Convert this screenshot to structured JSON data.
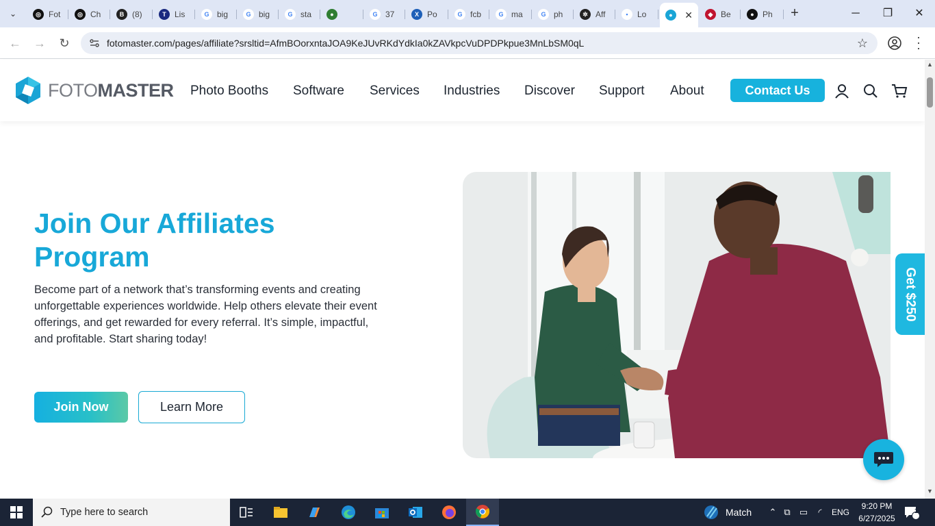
{
  "browser": {
    "tabs": [
      {
        "label": "Fot",
        "icon": "openai-icon"
      },
      {
        "label": "Ch",
        "icon": "openai-icon"
      },
      {
        "label": "(8)",
        "icon": "b-icon"
      },
      {
        "label": "Lis",
        "icon": "ttp-icon"
      },
      {
        "label": "big",
        "icon": "google-icon"
      },
      {
        "label": "big",
        "icon": "google-icon"
      },
      {
        "label": "sta",
        "icon": "google-icon"
      },
      {
        "label": "",
        "icon": "extension-icon"
      },
      {
        "label": "37",
        "icon": "google-icon"
      },
      {
        "label": "Po",
        "icon": "xf-icon"
      },
      {
        "label": "fcb",
        "icon": "google-icon"
      },
      {
        "label": "ma",
        "icon": "google-icon"
      },
      {
        "label": "ph",
        "icon": "google-icon"
      },
      {
        "label": "Aff",
        "icon": "aperture-icon"
      },
      {
        "label": "Lo",
        "icon": "page-icon"
      },
      {
        "label": "",
        "icon": "fotomaster-icon"
      },
      {
        "label": "Be",
        "icon": "diamond-icon"
      },
      {
        "label": "Ph",
        "icon": "circle-icon"
      }
    ],
    "url": "fotomaster.com/pages/affiliate?srsltid=AfmBOorxntaJOA9KeJUvRKdYdkIa0kZAVkpcVuDPDPkpue3MnLbSM0qL"
  },
  "site": {
    "logo": {
      "part1": "FOTO",
      "part2": "MASTER"
    },
    "nav": [
      "Photo Booths",
      "Software",
      "Services",
      "Industries",
      "Discover",
      "Support",
      "About"
    ],
    "contact_label": "Contact Us",
    "accent_color": "#17b2dd"
  },
  "hero": {
    "title": "Join Our Affiliates Program",
    "description": "Become part of a network that’s transforming events and creating unforgettable experiences worldwide. Help others elevate their event offerings, and get rewarded for every referral. It’s simple, impactful, and profitable. Start sharing today!",
    "join_label": "Join Now",
    "learn_label": "Learn More",
    "image_subject": "handshake-photo"
  },
  "side_tab": {
    "label": "Get $250"
  },
  "taskbar": {
    "search_placeholder": "Type here to search",
    "weather_label": "Match",
    "language": "ENG",
    "time": "9:20 PM",
    "date": "6/27/2025",
    "notification_count": "1"
  }
}
